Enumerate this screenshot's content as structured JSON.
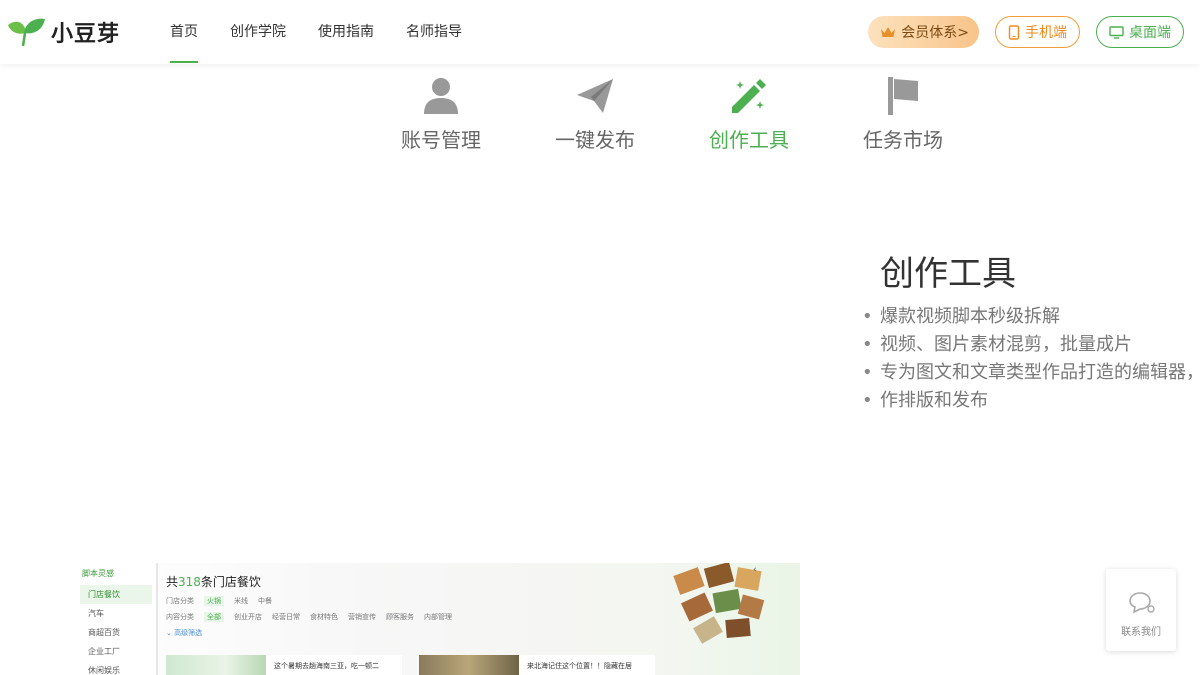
{
  "brand": {
    "name": "小豆芽"
  },
  "nav": {
    "items": [
      {
        "label": "首页",
        "active": true
      },
      {
        "label": "创作学院"
      },
      {
        "label": "使用指南"
      },
      {
        "label": "名师指导"
      }
    ]
  },
  "header_buttons": {
    "vip": "会员体系>",
    "mobile": "手机端",
    "desktop": "桌面端"
  },
  "features": [
    {
      "label": "账号管理",
      "icon": "user-icon"
    },
    {
      "label": "一键发布",
      "icon": "paper-plane-icon"
    },
    {
      "label": "创作工具",
      "icon": "pencil-sparkle-icon",
      "active": true
    },
    {
      "label": "任务市场",
      "icon": "flag-icon"
    }
  ],
  "detail": {
    "title": "创作工具",
    "points": [
      "爆款视频脚本秒级拆解",
      "视频、图片素材混剪，批量成片",
      "专为图文和文章类型作品打造的编辑器，",
      "作排版和发布"
    ]
  },
  "preview": {
    "sidebar_title": "脚本灵感",
    "sidebar_items": [
      "门店餐饮",
      "汽车",
      "商超百货",
      "企业工厂",
      "休闲娱乐"
    ],
    "count_prefix": "共",
    "count_num": "318",
    "count_suffix": "条门店餐饮",
    "row1": [
      "门店分类",
      "火锅",
      "米线",
      "中餐"
    ],
    "row2": [
      "内容分类",
      "全部",
      "创业开店",
      "经营日常",
      "食材特色",
      "营销宣传",
      "顾客服务",
      "内部管理"
    ],
    "advanced": "高级筛选",
    "card1_text": "这个暑期去趟海南三亚，吃一顿二",
    "card2_text": "来北海记住这个位置！！隐藏在居"
  },
  "service": {
    "label": "联系我们"
  },
  "colors": {
    "accent": "#4caf50",
    "vip": "#f8c48a",
    "mobile": "#f08a1d"
  }
}
